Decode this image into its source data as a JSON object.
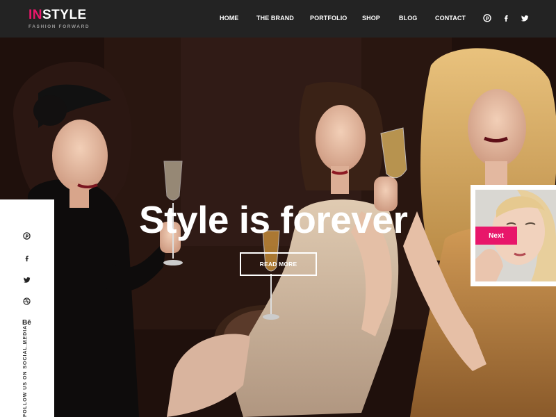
{
  "brand": {
    "accent": "IN",
    "name": "STYLE",
    "tagline": "FASHION FORWARD",
    "accent_color": "#e8166a"
  },
  "nav": {
    "items": [
      {
        "label": "HOME"
      },
      {
        "label": "THE BRAND"
      },
      {
        "label": "PORTFOLIO"
      },
      {
        "label": "SHOP"
      },
      {
        "label": "BLOG"
      },
      {
        "label": "CONTACT"
      }
    ],
    "social": [
      "pinterest-icon",
      "facebook-icon",
      "twitter-icon"
    ]
  },
  "hero": {
    "title": "Style is forever",
    "cta": "READ MORE"
  },
  "sidebar": {
    "social": [
      "pinterest-icon",
      "facebook-icon",
      "twitter-icon",
      "dribbble-icon",
      "behance-icon"
    ],
    "behance_label": "Bē",
    "follow_text": "FOLLOW US ON SOCIAL MEDIA"
  },
  "next": {
    "label": "Next"
  }
}
